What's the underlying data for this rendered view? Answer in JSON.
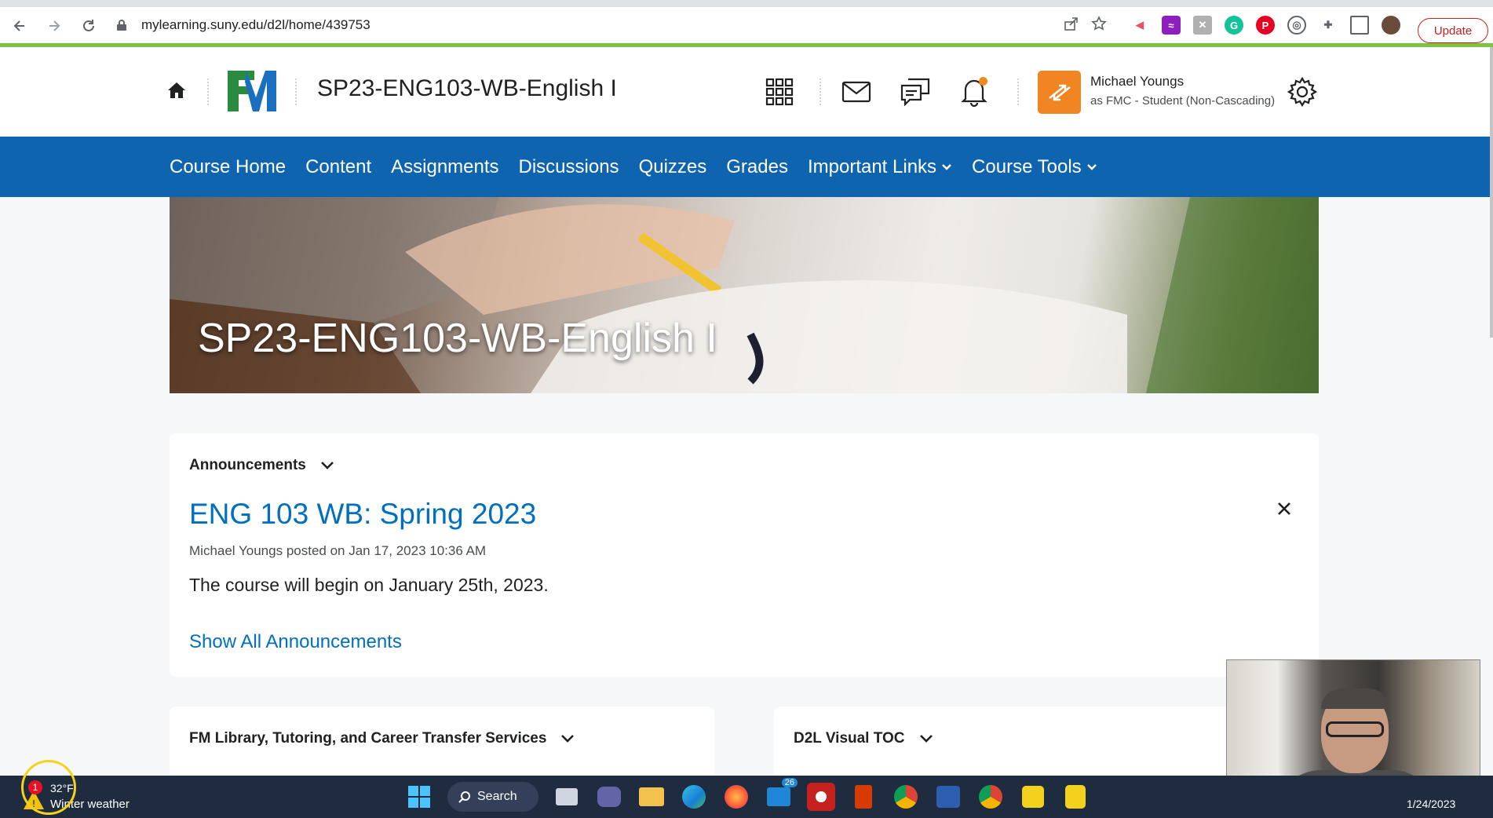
{
  "browser": {
    "url": "mylearning.suny.edu/d2l/home/439753",
    "update_label": "Update"
  },
  "header": {
    "course_title": "SP23-ENG103-WB-English I",
    "user_name": "Michael Youngs",
    "user_role": "as FMC - Student (Non-Cascading)"
  },
  "nav": {
    "items": [
      {
        "label": "Course Home",
        "dropdown": false
      },
      {
        "label": "Content",
        "dropdown": false
      },
      {
        "label": "Assignments",
        "dropdown": false
      },
      {
        "label": "Discussions",
        "dropdown": false
      },
      {
        "label": "Quizzes",
        "dropdown": false
      },
      {
        "label": "Grades",
        "dropdown": false
      },
      {
        "label": "Important Links",
        "dropdown": true
      },
      {
        "label": "Course Tools",
        "dropdown": true
      }
    ]
  },
  "banner": {
    "title": "SP23-ENG103-WB-English I"
  },
  "announcements": {
    "widget_title": "Announcements",
    "heading": "ENG 103 WB: Spring 2023",
    "meta": "Michael Youngs posted on Jan 17, 2023 10:36 AM",
    "body": "The course will begin on January 25th, 2023.",
    "show_all": "Show All Announcements"
  },
  "widgets": {
    "library_title": "FM Library, Tutoring, and Career Transfer Services",
    "toc_title": "D2L Visual TOC"
  },
  "taskbar": {
    "weather_temp": "32°F",
    "weather_desc": "Winter weather",
    "weather_badge": "1",
    "search_label": "Search",
    "mail_badge": "26",
    "date": "1/24/2023"
  },
  "colors": {
    "nav_bg": "#0f64b0",
    "link": "#006fbf",
    "accent_green": "#7dc242",
    "avatar_orange": "#f08522"
  }
}
